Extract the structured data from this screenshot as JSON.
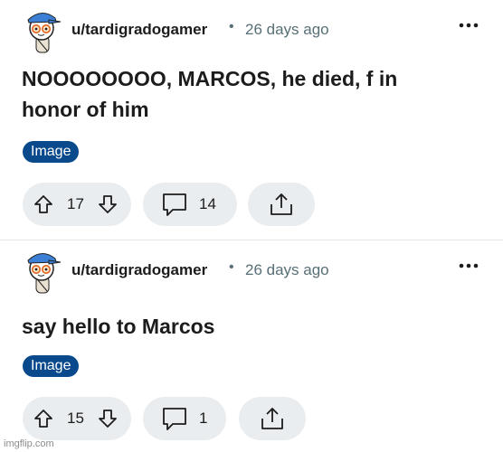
{
  "posts": [
    {
      "username": "u/tardigradogamer",
      "separator": "•",
      "time_ago": "26 days ago",
      "title_line1": "NOOOOOOOO, MARCOS, he died, f in",
      "title_line2": "honor of him",
      "flair": "Image",
      "votes": "17",
      "comments": "14"
    },
    {
      "username": "u/tardigradogamer",
      "separator": "•",
      "time_ago": "26 days ago",
      "title_line1": "say hello to Marcos",
      "flair": "Image",
      "votes": "15",
      "comments": "1"
    }
  ],
  "watermark": "imgflip.com",
  "colors": {
    "flair_bg": "#0a4a8c",
    "pill_bg": "#eaedef",
    "meta_text": "#576f76"
  },
  "icons": [
    "snoo-avatar-icon",
    "more-options-icon",
    "upvote-icon",
    "downvote-icon",
    "comment-icon",
    "share-icon"
  ]
}
